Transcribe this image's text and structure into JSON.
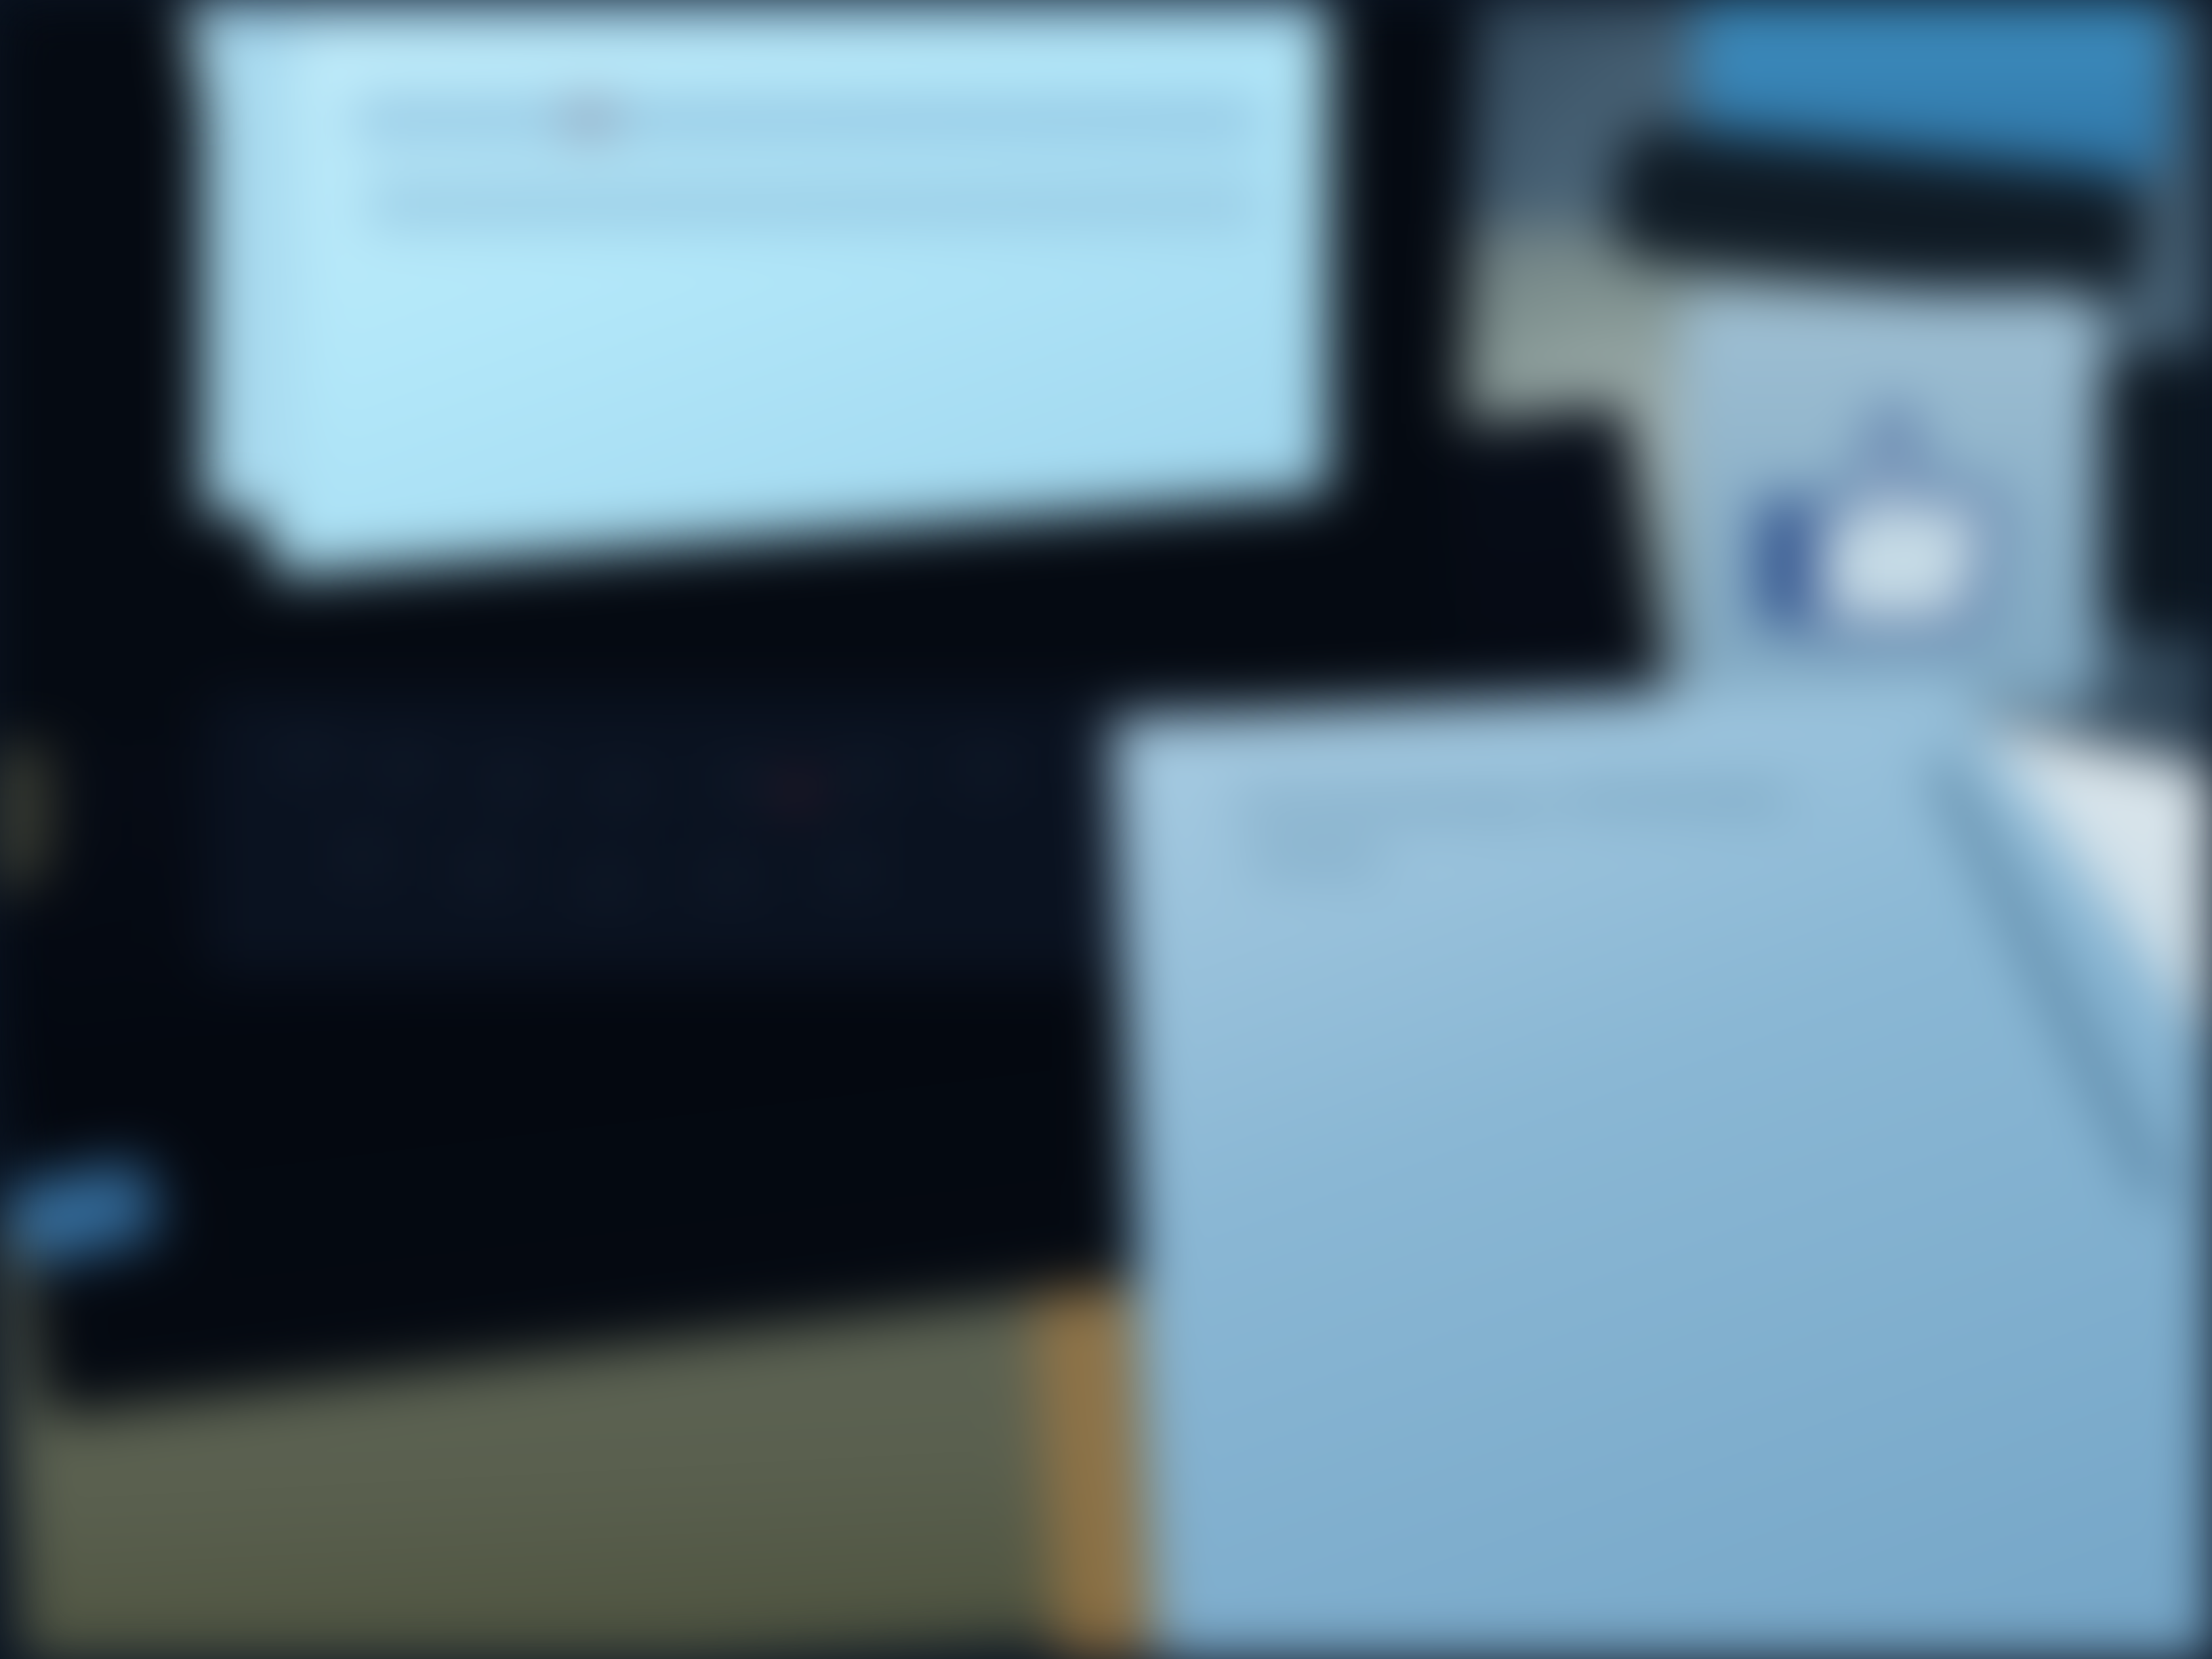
{
  "scene": {
    "subject": "",
    "colors": {
      "screen_glow": "#b8e9fb",
      "laptop_body": "#050a12",
      "notebook_paper": "#8ab7d4",
      "desk_surface": "#5a604f",
      "mug_logo": "#2d4e8a"
    },
    "icons": [
      "thumbs-up-icon"
    ]
  }
}
